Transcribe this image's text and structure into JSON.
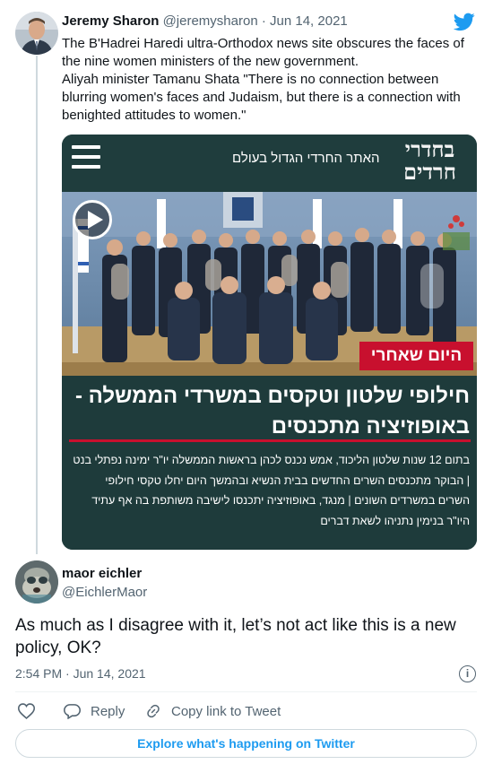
{
  "quoted_tweet": {
    "author_name": "Jeremy Sharon",
    "author_handle": "@jeremysharon",
    "separator": "·",
    "date": "Jun 14, 2021",
    "text_line1": "The B'Hadrei Haredi ultra-Orthodox news site obscures the faces of the nine women ministers of the new government.",
    "text_line2": "Aliyah minister Tamanu Shata \"There is no connection between blurring women's faces and Judaism, but there is a connection with benighted attitudes to women.\"",
    "media": {
      "site_tagline": "האתר החרדי הגדול בעולם",
      "site_logo": "בחדרי חרדים",
      "badge": "היום שאחרי",
      "headline": "חילופי שלטון וטקסים במשרדי הממשלה - באופוזיציה מתכנסים",
      "summary": "בתום 12 שנות שלטון הליכוד, אמש נכנס לכהן בראשות הממשלה יו\"ר ימינה נפתלי בנט | הבוקר מתכנסים השרים החדשים בבית הנשיא ובהמשך היום יחלו טקסי חילופי השרים במשרדים השונים | מנגד, באופוזיציה יתכנסו לישיבה משותפת בה אף עתיד היו\"ר בנימין נתניהו לשאת דברים"
    }
  },
  "reply_tweet": {
    "author_name": "maor eichler",
    "author_handle": "@EichlerMaor",
    "text": "As much as I disagree with it, let’s not act like this is a new policy, OK?",
    "time": "2:54 PM",
    "separator": "·",
    "date": "Jun 14, 2021"
  },
  "actions": {
    "reply_label": "Reply",
    "copy_link_label": "Copy link to Tweet",
    "explore_label": "Explore what's happening on Twitter"
  },
  "colors": {
    "twitter_blue": "#1d9bf0",
    "secondary_text": "#536471",
    "card_background": "#1e3b3b",
    "badge_red": "#c8102e"
  },
  "icons": [
    "twitter-bird-icon",
    "play-icon",
    "hamburger-menu-icon",
    "info-icon",
    "heart-icon",
    "reply-icon",
    "link-icon"
  ]
}
